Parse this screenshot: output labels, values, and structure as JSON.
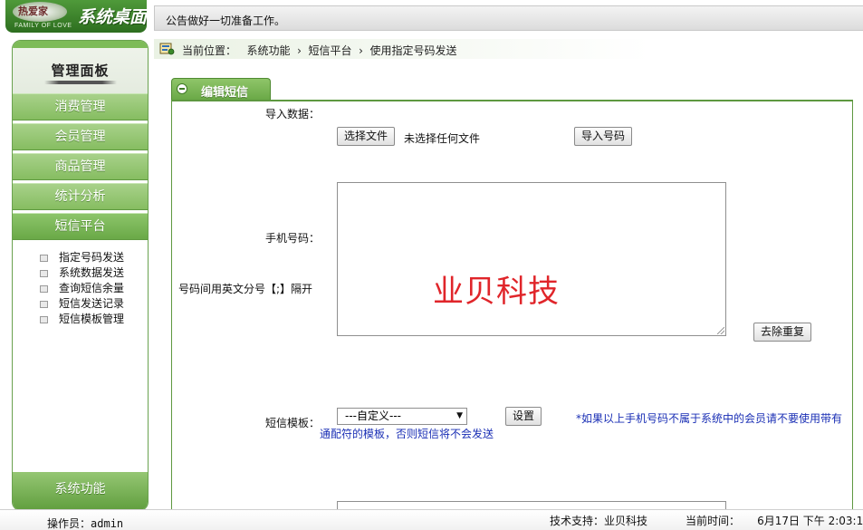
{
  "logo": {
    "badge_text": "热爱家",
    "sub_text": "FAMILY OF LOVE",
    "title": "系统桌面"
  },
  "notice": "公告做好一切准备工作。",
  "sidebar": {
    "title": "管理面板",
    "menu": [
      {
        "label": "消费管理"
      },
      {
        "label": "会员管理"
      },
      {
        "label": "商品管理"
      },
      {
        "label": "统计分析"
      },
      {
        "label": "短信平台"
      }
    ],
    "submenu": [
      {
        "label": "指定号码发送"
      },
      {
        "label": "系统数据发送"
      },
      {
        "label": "查询短信余量"
      },
      {
        "label": "短信发送记录"
      },
      {
        "label": "短信模板管理"
      }
    ],
    "footer": "系统功能"
  },
  "breadcrumb": {
    "text": "当前位置：   系统功能  ›  短信平台  ›  使用指定号码发送"
  },
  "form": {
    "tab_title": "编辑短信",
    "import_label": "导入数据：",
    "choose_file_button": "选择文件",
    "no_file_text": "未选择任何文件",
    "import_button": "导入号码",
    "phone_label": "手机号码：",
    "phone_hint": "号码间用英文分号【;】隔开",
    "phone_value": "",
    "watermark": "业贝科技",
    "dedupe_button": "去除重复",
    "template_label": "短信模板：",
    "template_selected": "---自定义---",
    "set_button": "设置",
    "warning_line1": "*如果以上手机号码不属于系统中的会员请不要使用带有",
    "warning_line2": "通配符的模板，否则短信将不会发送"
  },
  "status": {
    "operator_label": "操作员：",
    "operator_name": "admin",
    "support": "技术支持：业贝科技",
    "time": "当前时间：     6月17日 下午 2:03:18"
  },
  "colors": {
    "brand_green": "#6aa947",
    "hint_blue": "#1a2fb5",
    "watermark_red": "#e0252a"
  }
}
